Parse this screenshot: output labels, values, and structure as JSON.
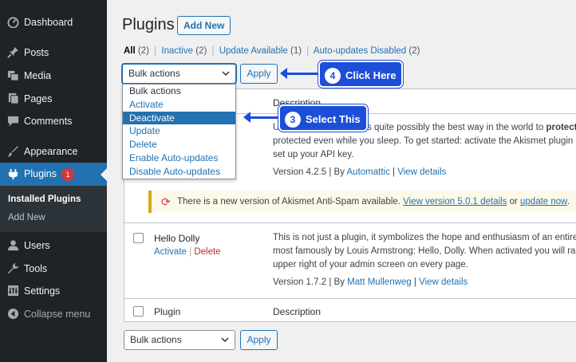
{
  "sidebar": {
    "items": [
      {
        "label": "Dashboard",
        "icon": "dashboard-icon"
      },
      {
        "label": "Posts",
        "icon": "pin-icon"
      },
      {
        "label": "Media",
        "icon": "media-icon"
      },
      {
        "label": "Pages",
        "icon": "page-icon"
      },
      {
        "label": "Comments",
        "icon": "comment-icon"
      },
      {
        "label": "Appearance",
        "icon": "brush-icon"
      },
      {
        "label": "Plugins",
        "icon": "plugin-icon",
        "badge": "1"
      },
      {
        "label": "Users",
        "icon": "user-icon"
      },
      {
        "label": "Tools",
        "icon": "wrench-icon"
      },
      {
        "label": "Settings",
        "icon": "settings-icon"
      },
      {
        "label": "Collapse menu",
        "icon": "collapse-icon"
      }
    ],
    "submenu": {
      "installed": "Installed Plugins",
      "add_new": "Add New"
    }
  },
  "page": {
    "title": "Plugins",
    "add_new": "Add New"
  },
  "filters": {
    "all": "All",
    "all_count": "(2)",
    "inactive": "Inactive",
    "inactive_count": "(2)",
    "update": "Update Available",
    "update_count": "(1)",
    "autoupd": "Auto-updates Disabled",
    "autoupd_count": "(2)",
    "sep": "|"
  },
  "bulk": {
    "selected": "Bulk actions",
    "apply": "Apply",
    "options": [
      "Bulk actions",
      "Activate",
      "Deactivate",
      "Update",
      "Delete",
      "Enable Auto-updates",
      "Disable Auto-updates"
    ],
    "highlighted": "Deactivate"
  },
  "table": {
    "col_plugin": "Plugin",
    "col_description": "Description",
    "akismet": {
      "desc1_pre": "U",
      "desc1_mid": " is quite possibly the best way in the world to ",
      "desc1_bold": "protect",
      "desc2": "protected even while you sleep. To get started: activate the Akismet plugin and",
      "desc3": "set up your API key.",
      "version": "Version 4.2.5",
      "by": "| By",
      "author": "Automattic",
      "details_sep": "|",
      "details": "View details"
    },
    "notice": {
      "icon": "refresh-icon",
      "text": "There is a new version of Akismet Anti-Spam available.",
      "link1": "View version 5.0.1 details",
      "or": "or",
      "link2": "update now",
      "end": "."
    },
    "hello": {
      "name": "Hello Dolly",
      "activate": "Activate",
      "sep": "|",
      "delete": "Delete",
      "desc1": "This is not just a plugin, it symbolizes the hope and enthusiasm of an entire ger",
      "desc2": "most famously by Louis Armstrong: Hello, Dolly. When activated you will rando",
      "desc3": "upper right of your admin screen on every page.",
      "version": "Version 1.7.2",
      "by": "| By",
      "author": "Matt Mullenweg",
      "details_sep": "|",
      "details": "View details"
    }
  },
  "callouts": {
    "click": {
      "num": "4",
      "text": "Click Here"
    },
    "select": {
      "num": "3",
      "text": "Select This"
    }
  },
  "colors": {
    "accent": "#2271b1",
    "sidebar": "#1d2327",
    "callout": "#1c4ed8"
  }
}
